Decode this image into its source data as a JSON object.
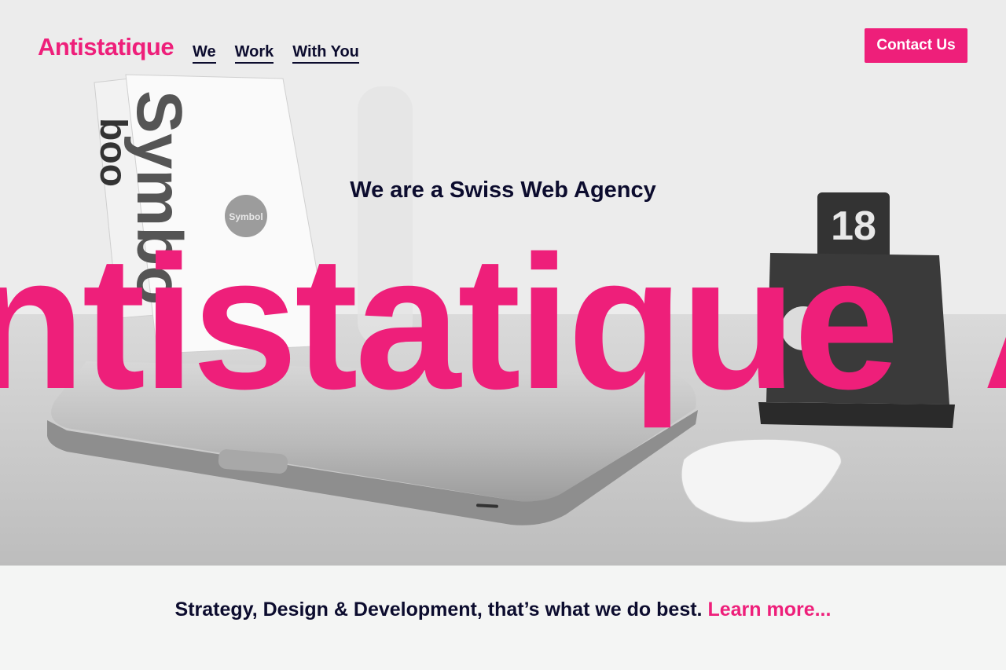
{
  "header": {
    "logo": "Antistatique",
    "nav": [
      {
        "label": "We"
      },
      {
        "label": "Work"
      },
      {
        "label": "With You"
      }
    ],
    "contact_label": "Contact Us"
  },
  "hero": {
    "tagline": "We are a Swiss Web Agency",
    "marquee_parts": [
      "Antistatique",
      "Antistatique"
    ],
    "scene": {
      "book_spine_text": "Symbo",
      "book_logo_text": "boo",
      "sticker_text": "Symbol",
      "table_number": "18"
    }
  },
  "intro": {
    "text": "Strategy, Design & Development, that’s what we do best.",
    "link_label": "Learn more..."
  },
  "colors": {
    "brand_pink": "#ee1f7a",
    "navy_text": "#0c0c2e",
    "band_background": "#f4f5f4"
  }
}
